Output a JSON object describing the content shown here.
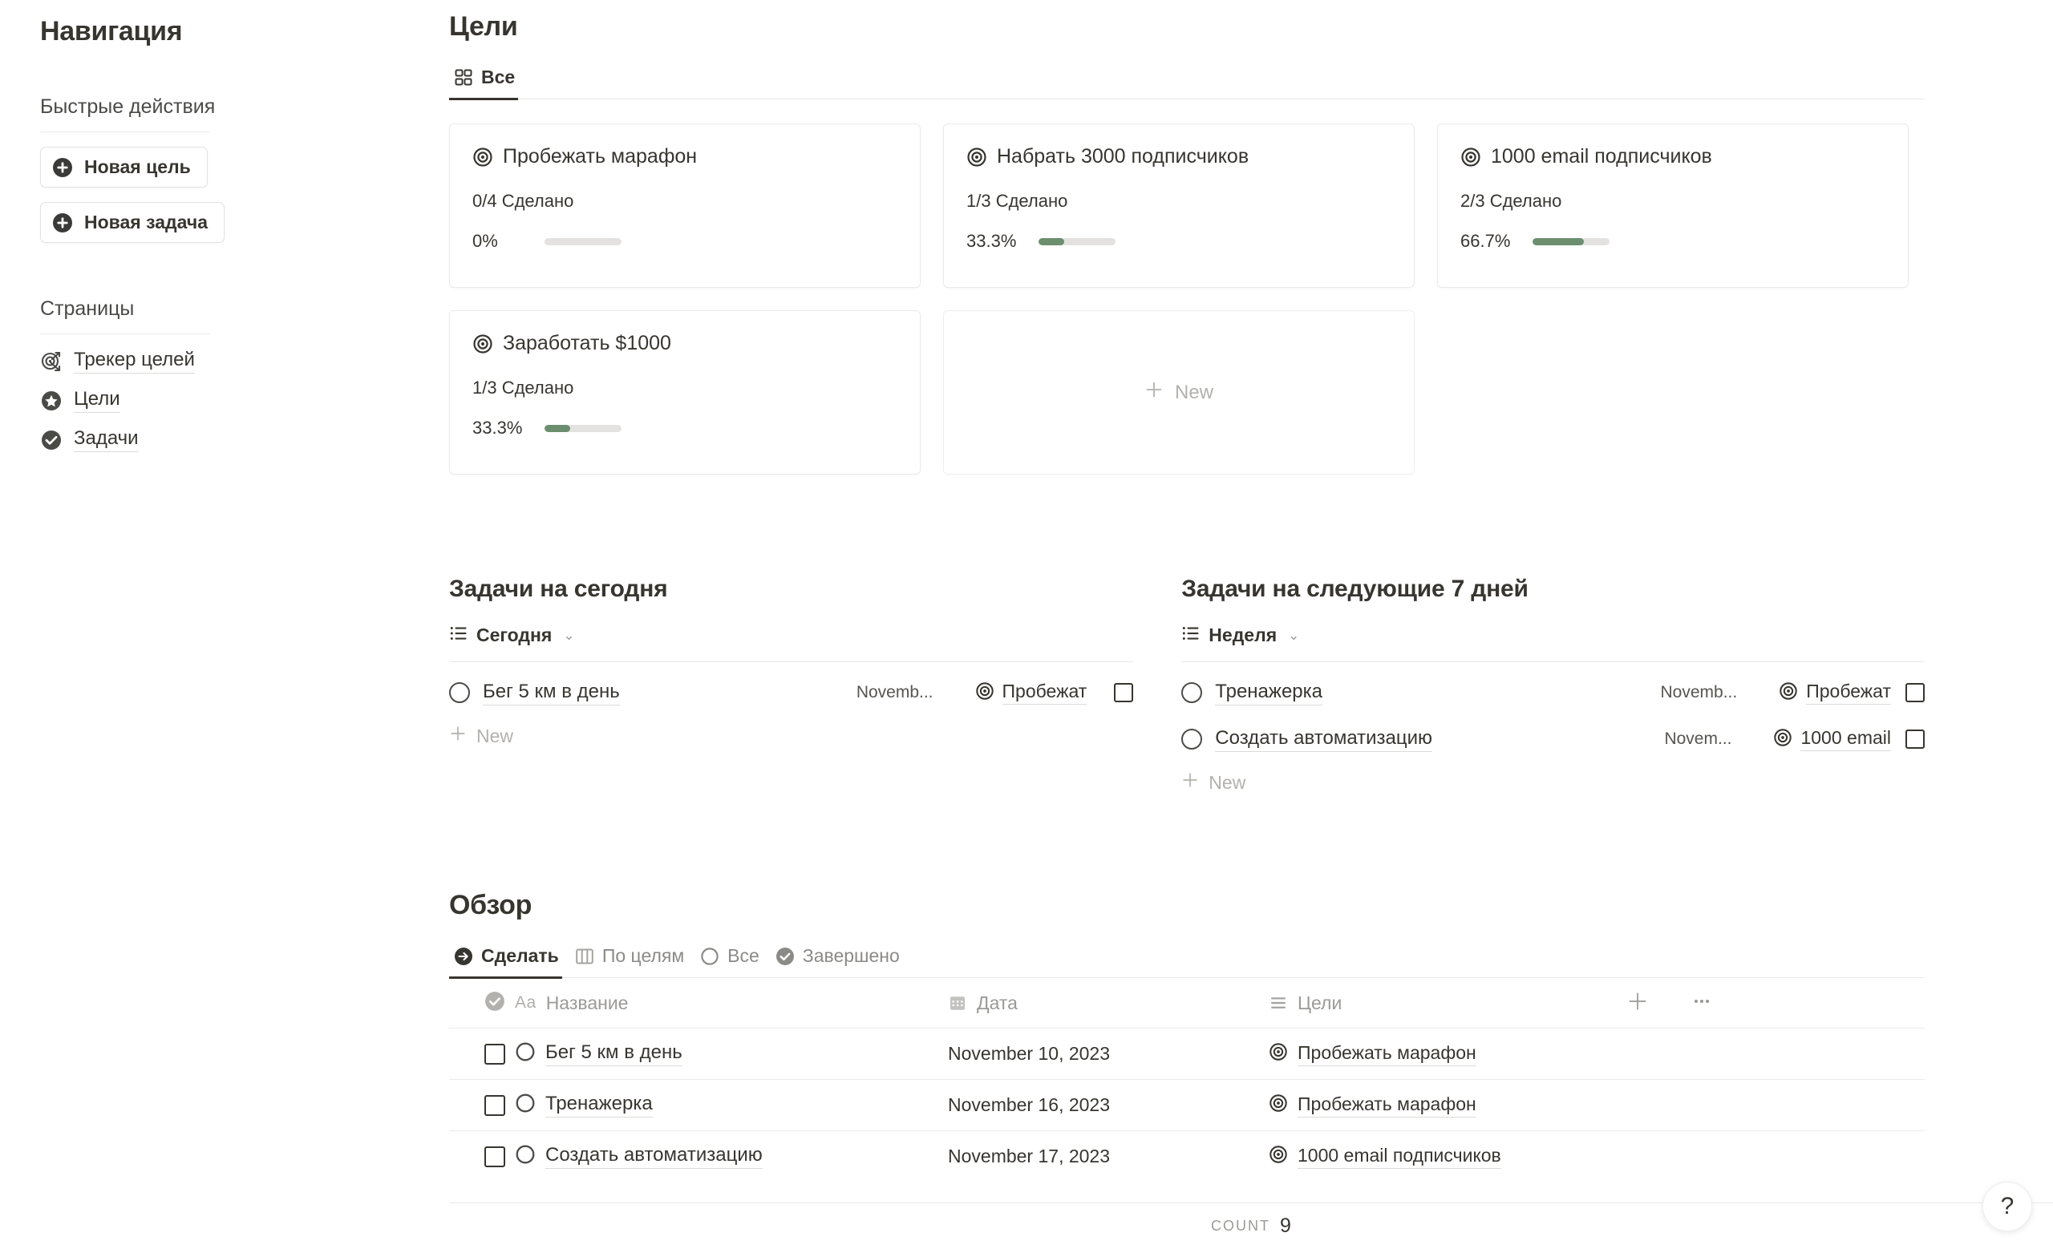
{
  "sidebar": {
    "title": "Навигация",
    "quick_actions_label": "Быстрые действия",
    "buttons": [
      {
        "label": "Новая цель",
        "icon": "plus-circle-icon"
      },
      {
        "label": "Новая задача",
        "icon": "plus-circle-icon"
      }
    ],
    "pages_label": "Страницы",
    "pages": [
      {
        "label": "Трекер целей",
        "icon": "target-arrow-icon"
      },
      {
        "label": "Цели",
        "icon": "star-circle-icon"
      },
      {
        "label": "Задачи",
        "icon": "check-circle-icon"
      }
    ]
  },
  "goals": {
    "title": "Цели",
    "tabs": [
      {
        "label": "Все",
        "icon": "grid-icon",
        "active": true
      }
    ],
    "cards": [
      {
        "title": "Пробежать марафон",
        "done": "0/4 Сделано",
        "percent_label": "0%",
        "percent": 0
      },
      {
        "title": "Набрать 3000 подписчиков",
        "done": "1/3 Сделано",
        "percent_label": "33.3%",
        "percent": 33.3
      },
      {
        "title": "1000 email подписчиков",
        "done": "2/3 Сделано",
        "percent_label": "66.7%",
        "percent": 66.7
      },
      {
        "title": "Заработать $1000",
        "done": "1/3 Сделано",
        "percent_label": "33.3%",
        "percent": 33.3
      }
    ],
    "new_card_label": "New"
  },
  "today": {
    "title": "Задачи на сегодня",
    "view_label": "Сегодня",
    "rows": [
      {
        "name": "Бег 5 км в день",
        "date": "Novemb...",
        "goal": "Пробежат"
      }
    ],
    "new_label": "New"
  },
  "week": {
    "title": "Задачи на следующие 7 дней",
    "view_label": "Неделя",
    "rows": [
      {
        "name": "Тренажерка",
        "date": "Novemb...",
        "goal": "Пробежат"
      },
      {
        "name": "Создать автоматизацию",
        "date": "Novem...",
        "goal": "1000 email"
      }
    ],
    "new_label": "New"
  },
  "overview": {
    "title": "Обзор",
    "tabs": [
      {
        "label": "Сделать",
        "icon": "arrow-right-circle-icon",
        "active": true
      },
      {
        "label": "По целям",
        "icon": "board-icon",
        "active": false
      },
      {
        "label": "Все",
        "icon": "circle-icon",
        "active": false
      },
      {
        "label": "Завершено",
        "icon": "check-circle-icon",
        "active": false
      }
    ],
    "columns": [
      {
        "label": "Название",
        "icon": "title-aa-icon"
      },
      {
        "label": "Дата",
        "icon": "calendar-icon"
      },
      {
        "label": "Цели",
        "icon": "list-icon"
      }
    ],
    "rows": [
      {
        "name": "Бег 5 км в день",
        "date": "November 10, 2023",
        "goal": "Пробежать марафон"
      },
      {
        "name": "Тренажерка",
        "date": "November 16, 2023",
        "goal": "Пробежать марафон"
      },
      {
        "name": "Создать автоматизацию",
        "date": "November 17, 2023",
        "goal": "1000 email подписчиков"
      }
    ],
    "add_column_icon": "plus-icon",
    "more_icon": "ellipsis-icon"
  },
  "footer": {
    "count_label": "COUNT",
    "count_value": "9"
  },
  "help": {
    "label": "?"
  },
  "colors": {
    "accent_green": "#6b8e6f",
    "track_gray": "#e3e2e0",
    "text": "#37352f",
    "muted": "#9b9a97"
  }
}
